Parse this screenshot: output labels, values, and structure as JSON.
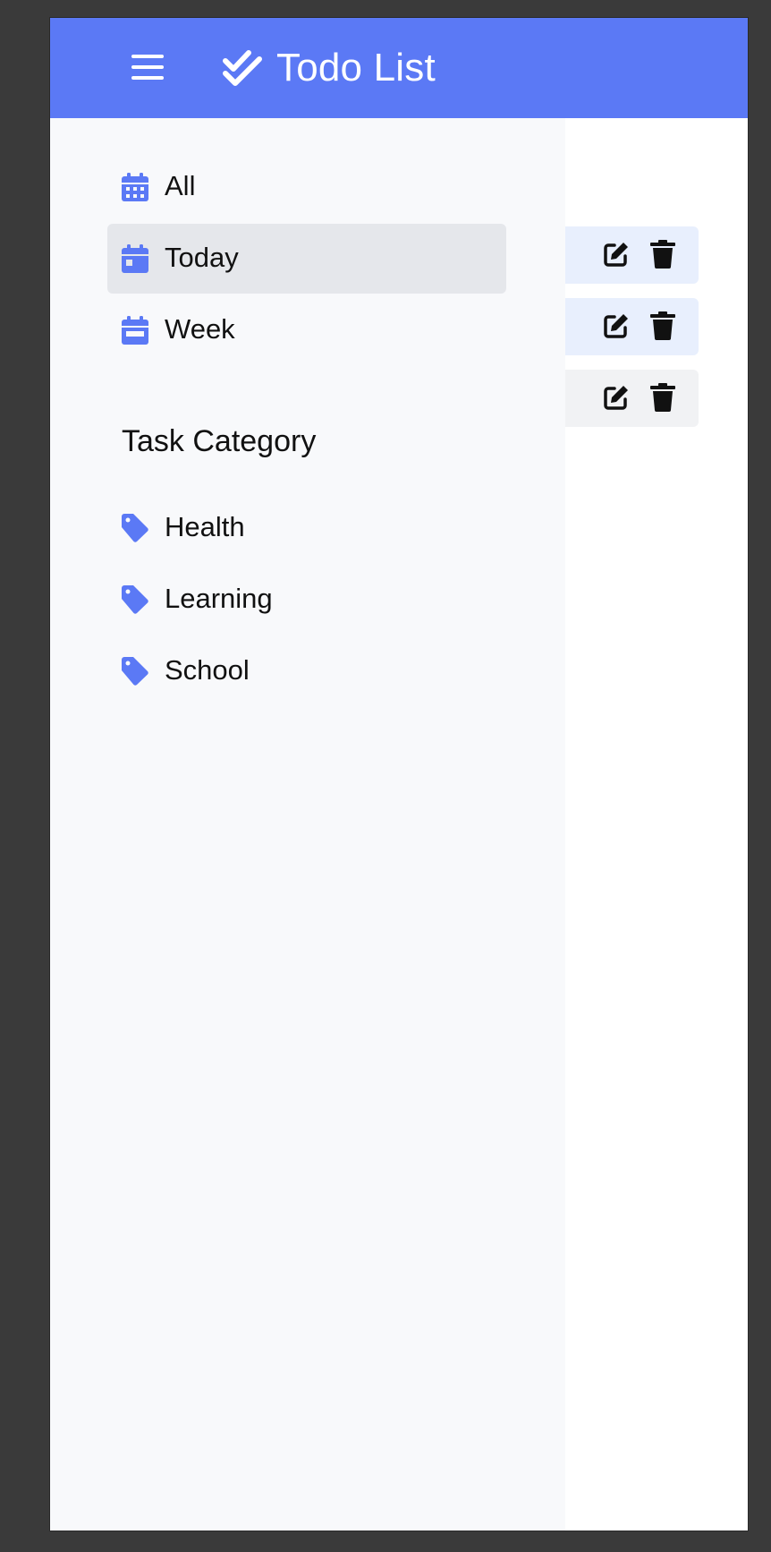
{
  "app": {
    "title": "Todo List",
    "accent_color": "#5b79f5"
  },
  "header": {
    "menu_icon": "hamburger-menu-icon",
    "logo_icon": "double-check-icon"
  },
  "sidebar": {
    "nav_items": [
      {
        "label": "All",
        "icon": "calendar-days-icon",
        "active": false
      },
      {
        "label": "Today",
        "icon": "calendar-day-icon",
        "active": true
      },
      {
        "label": "Week",
        "icon": "calendar-week-icon",
        "active": false
      }
    ],
    "category_title": "Task Category",
    "categories": [
      {
        "label": "Health",
        "icon": "tag-icon"
      },
      {
        "label": "Learning",
        "icon": "tag-icon"
      },
      {
        "label": "School",
        "icon": "tag-icon"
      }
    ]
  },
  "tasks": {
    "row_colors": [
      "#e8effd",
      "#e8effd",
      "#f1f2f4"
    ],
    "actions": [
      "edit-icon",
      "trash-icon"
    ]
  }
}
